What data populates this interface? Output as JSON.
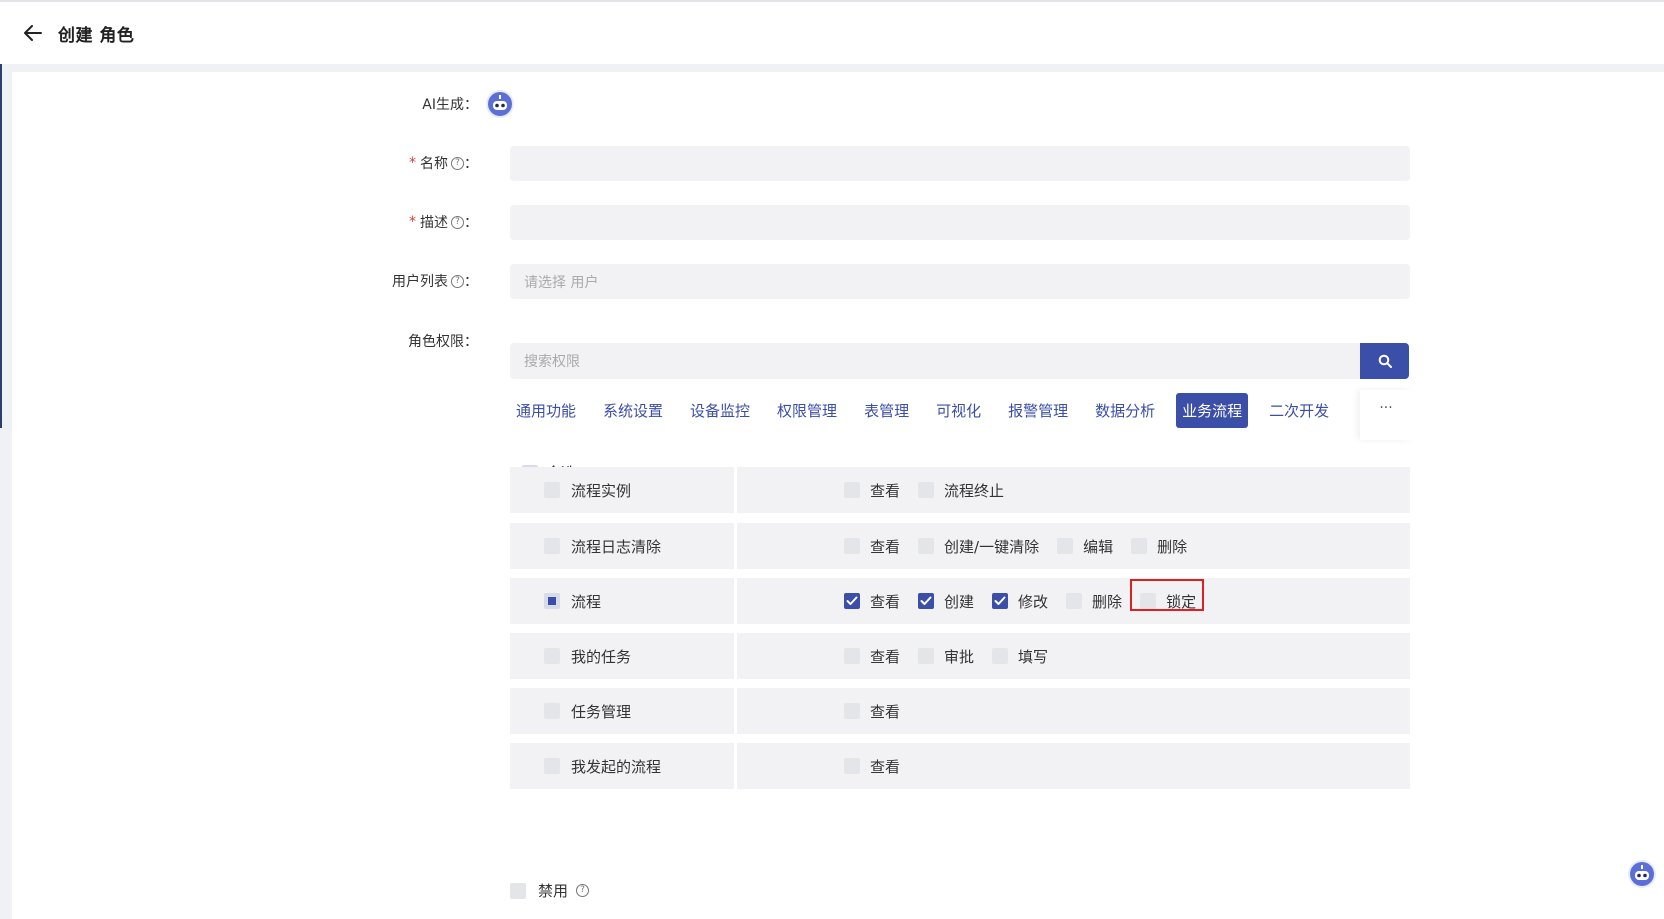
{
  "header": {
    "title": "创建 角色"
  },
  "form": {
    "ai_label": "AI生成：",
    "name_label": "名称",
    "desc_label": "描述",
    "users_label": "用户列表",
    "users_placeholder": "请选择 用户",
    "perm_label": "角色权限：",
    "search_placeholder": "搜索权限",
    "colon": "：",
    "required_mark": "*",
    "help_mark": "?"
  },
  "tabs": [
    "通用功能",
    "系统设置",
    "设备监控",
    "权限管理",
    "表管理",
    "可视化",
    "报警管理",
    "数据分析",
    "业务流程",
    "二次开发"
  ],
  "active_tab": "业务流程",
  "more_label": "···",
  "select_all": {
    "label": "全选",
    "state": "indeterminate"
  },
  "rows": [
    {
      "name": "流程实例",
      "state": "unchecked",
      "perms": [
        {
          "label": "查看",
          "checked": false
        },
        {
          "label": "流程终止",
          "checked": false
        }
      ]
    },
    {
      "name": "流程日志清除",
      "state": "unchecked",
      "perms": [
        {
          "label": "查看",
          "checked": false
        },
        {
          "label": "创建/一键清除",
          "checked": false
        },
        {
          "label": "编辑",
          "checked": false
        },
        {
          "label": "删除",
          "checked": false
        }
      ]
    },
    {
      "name": "流程",
      "state": "indeterminate",
      "perms": [
        {
          "label": "查看",
          "checked": true
        },
        {
          "label": "创建",
          "checked": true
        },
        {
          "label": "修改",
          "checked": true
        },
        {
          "label": "删除",
          "checked": false
        },
        {
          "label": "锁定",
          "checked": false,
          "highlighted": true
        }
      ]
    },
    {
      "name": "我的任务",
      "state": "unchecked",
      "perms": [
        {
          "label": "查看",
          "checked": false
        },
        {
          "label": "审批",
          "checked": false
        },
        {
          "label": "填写",
          "checked": false
        }
      ]
    },
    {
      "name": "任务管理",
      "state": "unchecked",
      "perms": [
        {
          "label": "查看",
          "checked": false
        }
      ]
    },
    {
      "name": "我发起的流程",
      "state": "unchecked",
      "perms": [
        {
          "label": "查看",
          "checked": false
        }
      ]
    }
  ],
  "disabled": {
    "label": "禁用"
  },
  "colors": {
    "accent": "#3b4ea8",
    "highlight": "#e02020",
    "required": "#e53935"
  }
}
